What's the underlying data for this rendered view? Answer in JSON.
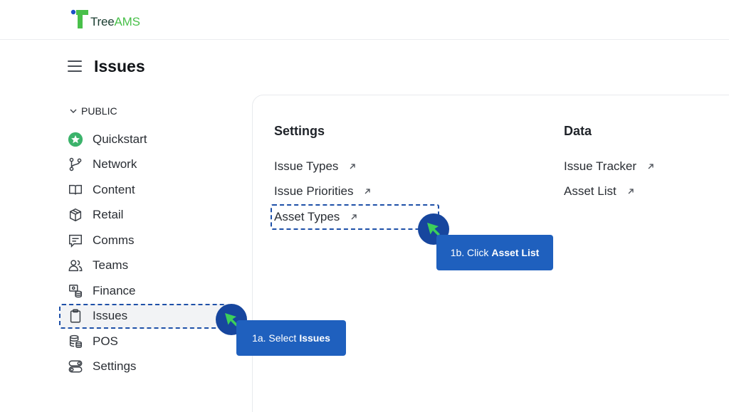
{
  "brand": {
    "name_part1": "Tree",
    "name_part2": "AMS",
    "icon": "tree-ams-logo"
  },
  "header": {
    "menu_icon": "hamburger-icon",
    "title": "Issues"
  },
  "sidebar": {
    "section": "PUBLIC",
    "items": [
      {
        "label": "Quickstart",
        "icon": "star-icon"
      },
      {
        "label": "Network",
        "icon": "git-branch-icon"
      },
      {
        "label": "Content",
        "icon": "book-icon"
      },
      {
        "label": "Retail",
        "icon": "box-icon"
      },
      {
        "label": "Comms",
        "icon": "message-icon"
      },
      {
        "label": "Teams",
        "icon": "users-icon"
      },
      {
        "label": "Finance",
        "icon": "finance-icon"
      },
      {
        "label": "Issues",
        "icon": "clipboard-icon",
        "active": true
      },
      {
        "label": "POS",
        "icon": "database-icon"
      },
      {
        "label": "Settings",
        "icon": "toggles-icon"
      }
    ]
  },
  "main": {
    "settings": {
      "title": "Settings",
      "links": [
        "Issue Types",
        "Issue Priorities",
        "Asset Types"
      ]
    },
    "data": {
      "title": "Data",
      "links": [
        "Issue Tracker",
        "Asset List"
      ]
    }
  },
  "annotations": {
    "step_a": {
      "prefix": "1a. Select",
      "bold": "Issues"
    },
    "step_b": {
      "prefix": "1b. Click",
      "bold": "Asset List"
    }
  },
  "colors": {
    "accent": "#1f60be",
    "highlight_border": "#1e50a8",
    "cursor_circle": "#17469e",
    "cursor_arrow": "#3ccf5a",
    "logo_green": "#49c04a",
    "logo_blue": "#1e50c8"
  }
}
